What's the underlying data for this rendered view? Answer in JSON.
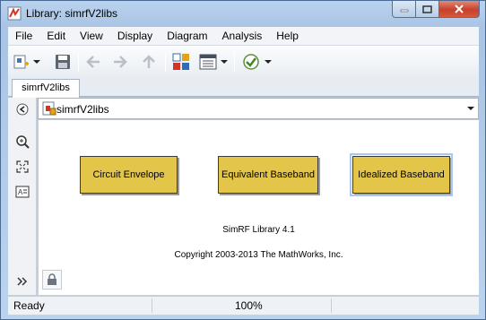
{
  "window": {
    "title": "Library: simrfV2libs"
  },
  "menu": [
    "File",
    "Edit",
    "View",
    "Display",
    "Diagram",
    "Analysis",
    "Help"
  ],
  "toolbar": {
    "icons": [
      "new-model-icon",
      "save-icon",
      "back-icon",
      "forward-icon",
      "up-icon",
      "library-browser-icon",
      "model-explorer-icon",
      "check-icon"
    ]
  },
  "tabs": [
    {
      "label": "simrfV2libs"
    }
  ],
  "address": {
    "path": "simrfV2libs"
  },
  "blocks": [
    {
      "label": "Circuit Envelope"
    },
    {
      "label": "Equivalent Baseband"
    },
    {
      "label": "Idealized Baseband"
    }
  ],
  "library": {
    "version": "SimRF Library 4.1",
    "copyright": "Copyright 2003-2013 The MathWorks, Inc."
  },
  "status": {
    "state": "Ready",
    "zoom": "100%"
  },
  "colors": {
    "block_fill": "#e3c54a",
    "title_bar": "#b9d2ee",
    "close_button": "#c7402a"
  }
}
